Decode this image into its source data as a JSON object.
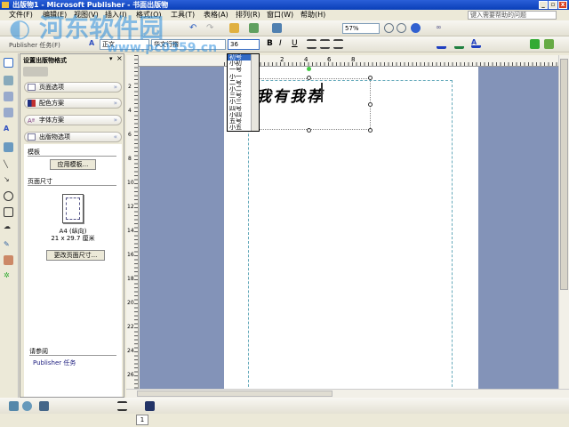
{
  "window": {
    "title": "出版物1 - Microsoft Publisher - 书面出版物",
    "min": "_",
    "max": "▫",
    "close": "x"
  },
  "menu": [
    "文件(F)",
    "编辑(E)",
    "视图(V)",
    "插入(I)",
    "格式(O)",
    "工具(T)",
    "表格(A)",
    "排列(R)",
    "窗口(W)",
    "帮助(H)"
  ],
  "help_placeholder": "键入需要帮助的问题",
  "toolbar": {
    "zoom": "57%",
    "task_label": "Publisher 任务(F)",
    "style": "正文",
    "font": "华文行楷",
    "size": "36"
  },
  "fontsize_options": [
    "初号",
    "小初",
    "一号",
    "小一",
    "二号",
    "小二",
    "三号",
    "小三",
    "四号",
    "小四",
    "五号",
    "小五"
  ],
  "pane": {
    "title": "设置出版物格式",
    "sections": [
      "页面选项",
      "配色方案",
      "字体方案",
      "出版物选项"
    ],
    "template_label": "模板",
    "apply_template": "应用模板...",
    "page_size_label": "页面尺寸",
    "page_size_name": "A4 (纵向)",
    "page_size_dims": "21 x 29.7 厘米",
    "change_size": "更改页面尺寸...",
    "see_also": "请参阅",
    "publisher_tasks": "Publisher 任务"
  },
  "document": {
    "text": "我有我荐"
  },
  "ruler": {
    "h": [
      "2",
      "4",
      "6",
      "8"
    ],
    "v": [
      "2",
      "4",
      "6",
      "8",
      "10",
      "12",
      "14",
      "16",
      "18",
      "20",
      "22",
      "24",
      "26"
    ]
  },
  "status": {
    "page": "1"
  },
  "watermark": {
    "name": "河东软件园",
    "url": "www.pc0359.cn"
  }
}
